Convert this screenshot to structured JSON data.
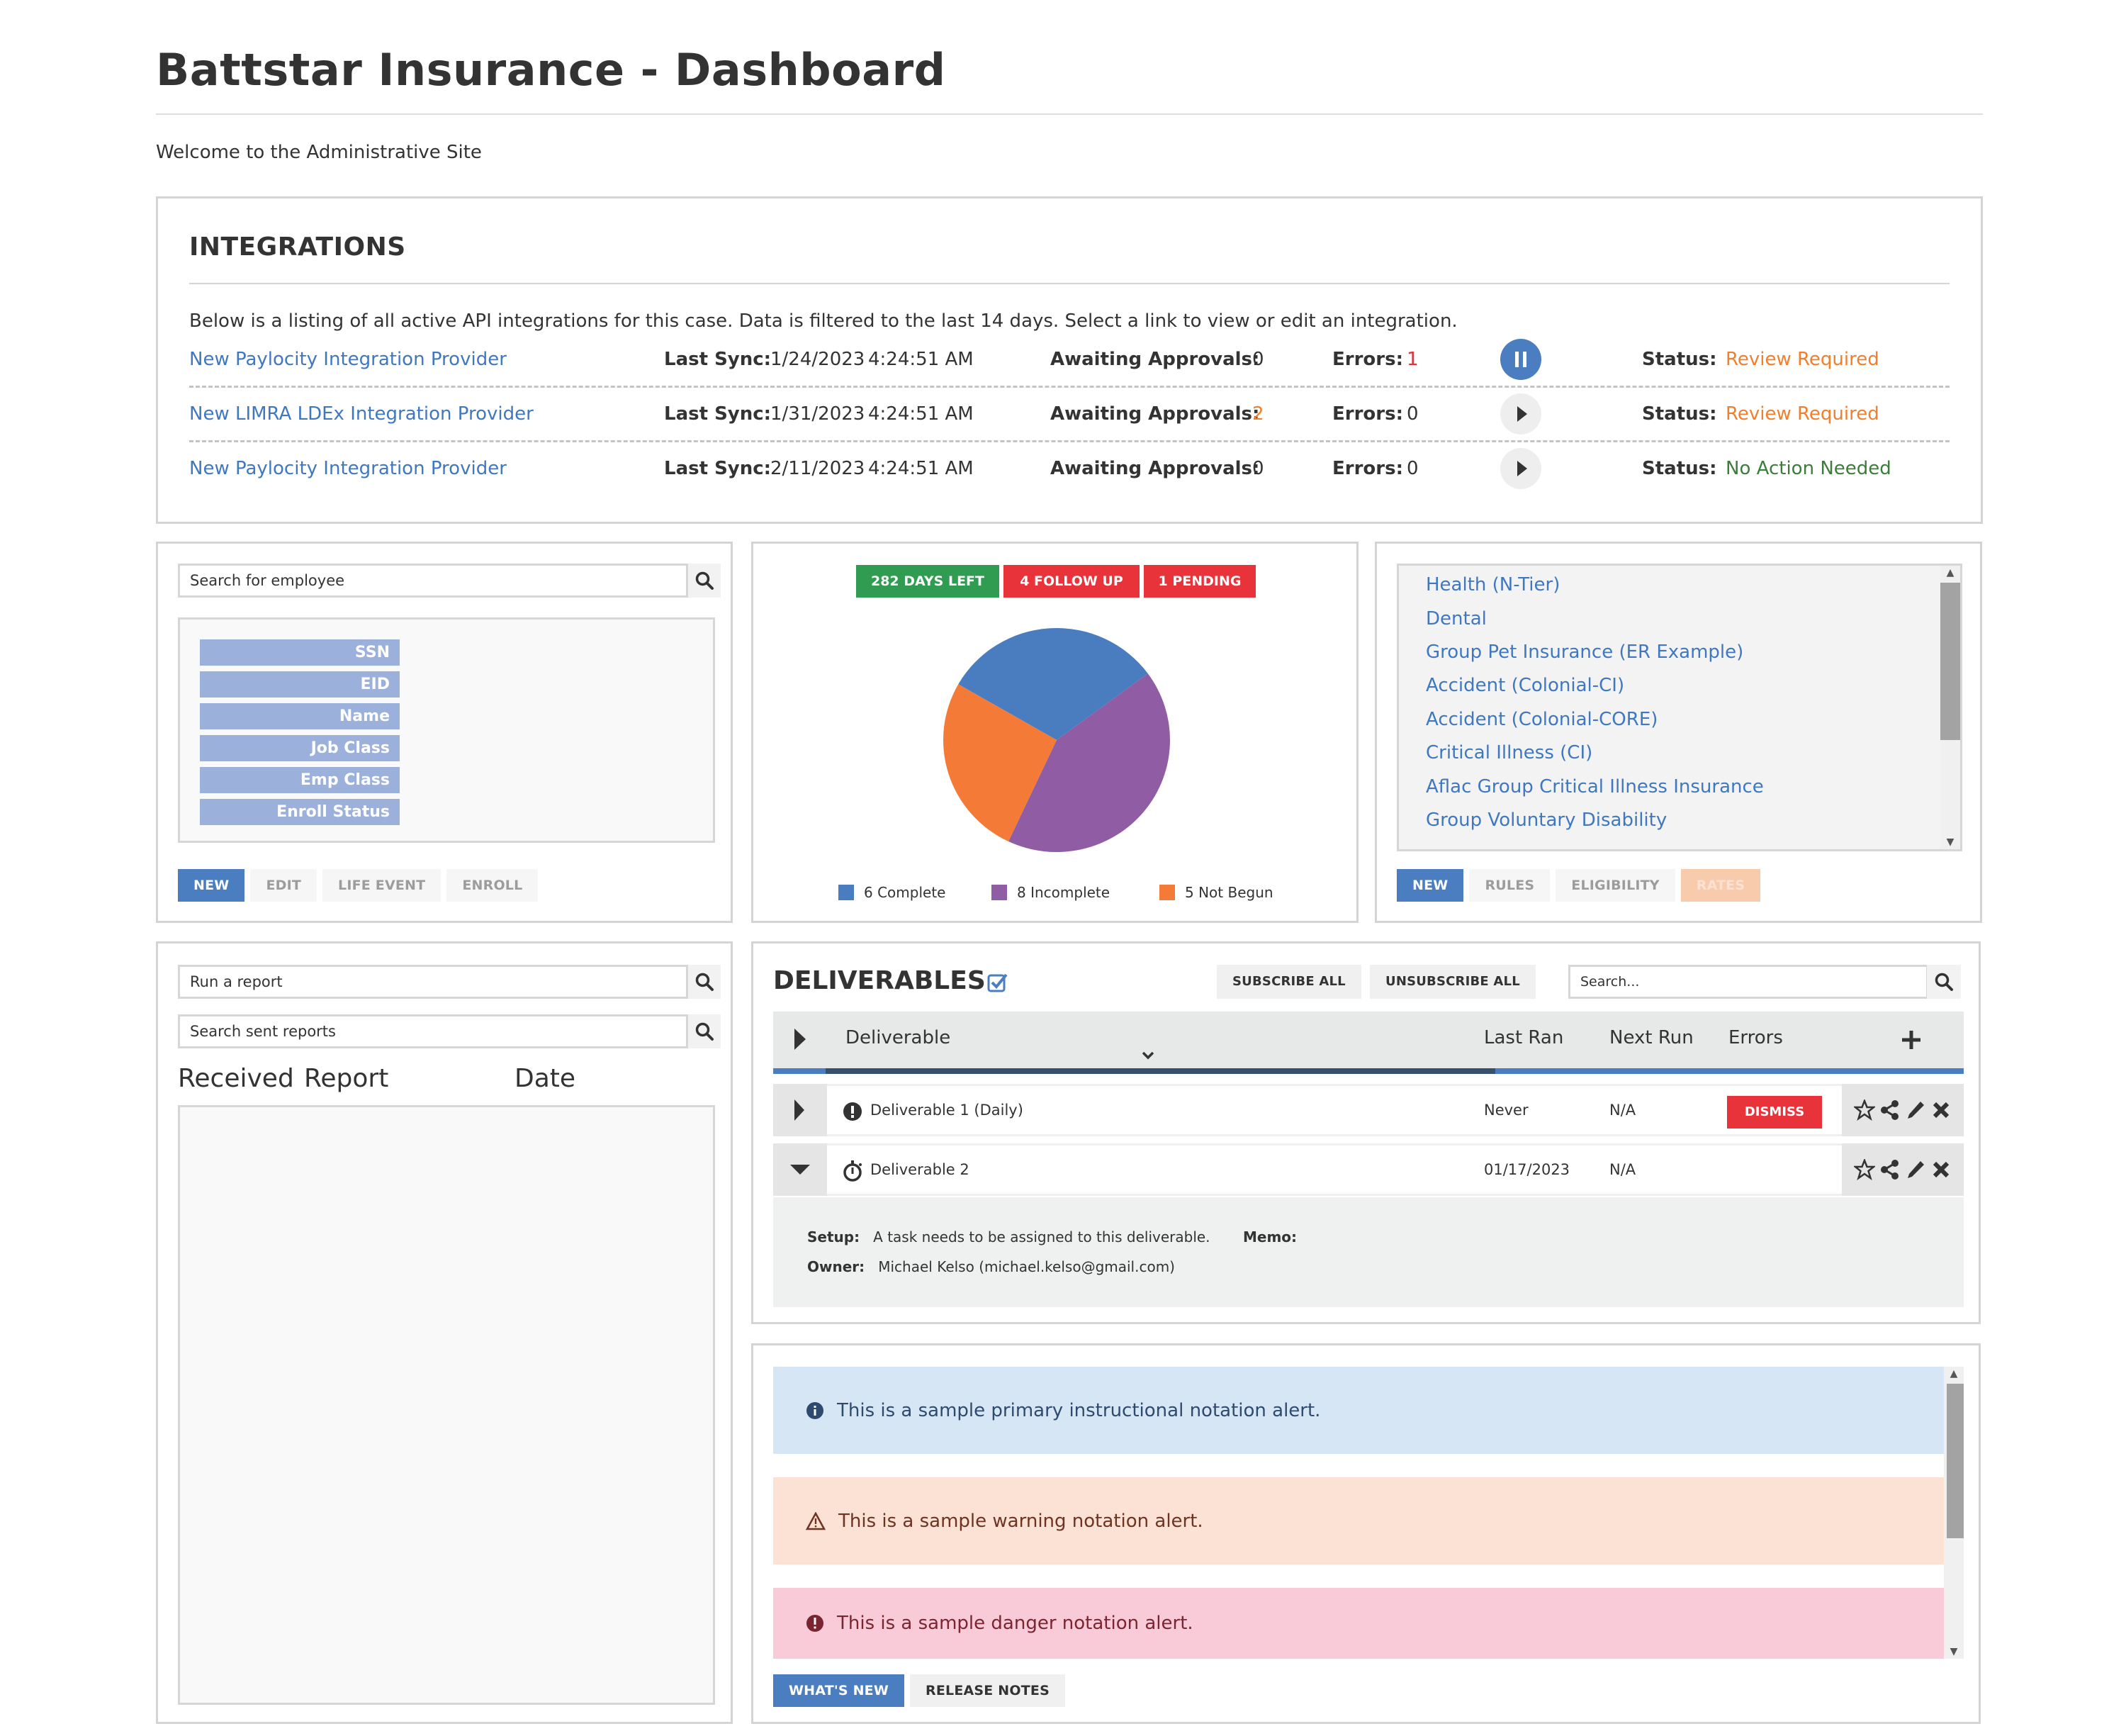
{
  "header": {
    "title": "Battstar Insurance - Dashboard",
    "welcome": "Welcome to the Administrative Site"
  },
  "integrations": {
    "heading": "INTEGRATIONS",
    "description": "Below is a listing of all active API integrations for this case. Data is filtered to the last 14 days. Select a link to view or edit an integration.",
    "labels": {
      "last_sync": "Last Sync:",
      "awaiting": "Awaiting Approvals:",
      "errors": "Errors:",
      "status": "Status:"
    },
    "rows": [
      {
        "name": "New Paylocity Integration Provider",
        "date": "1/24/2023",
        "time": "4:24:51 AM",
        "awaiting": "0",
        "errors": "1",
        "control": "pause",
        "status": "Review Required",
        "status_color": "#f07f2f",
        "awaiting_color": "#333333",
        "errors_color": "#e0323a"
      },
      {
        "name": "New LIMRA LDEx Integration Provider",
        "date": "1/31/2023",
        "time": "4:24:51 AM",
        "awaiting": "2",
        "errors": "0",
        "control": "play",
        "status": "Review Required",
        "status_color": "#f07f2f",
        "awaiting_color": "#f07f2f",
        "errors_color": "#333333"
      },
      {
        "name": "New Paylocity Integration Provider",
        "date": "2/11/2023",
        "time": "4:24:51 AM",
        "awaiting": "0",
        "errors": "0",
        "control": "play",
        "status": "No Action Needed",
        "status_color": "#3c7d3a",
        "awaiting_color": "#333333",
        "errors_color": "#333333"
      }
    ]
  },
  "employees": {
    "search_placeholder": "Search for employee",
    "fields": [
      "SSN",
      "EID",
      "Name",
      "Job Class",
      "Emp Class",
      "Enroll Status"
    ],
    "buttons": {
      "new": "NEW",
      "edit": "EDIT",
      "life_event": "LIFE EVENT",
      "enroll": "ENROLL"
    }
  },
  "enrollment": {
    "badges": [
      {
        "label": "282 DAYS LEFT",
        "color": "#2f9c52"
      },
      {
        "label": "4 FOLLOW UP",
        "color": "#e8333b"
      },
      {
        "label": "1 PENDING",
        "color": "#e8333b"
      }
    ]
  },
  "chart_data": {
    "type": "pie",
    "title": "",
    "categories": [
      "Complete",
      "Incomplete",
      "Not Begun"
    ],
    "values": [
      6,
      8,
      5
    ],
    "colors": [
      "#4a7dbf",
      "#905ca4",
      "#f47b37"
    ],
    "legend": [
      "6 Complete",
      "8 Incomplete",
      "5 Not Begun"
    ],
    "legend_position": "bottom"
  },
  "plans": {
    "items": [
      "Health (N-Tier)",
      "Dental",
      "Group Pet Insurance (ER Example)",
      "Accident (Colonial-CI)",
      "Accident (Colonial-CORE)",
      "Critical Illness (CI)",
      "Aflac Group Critical Illness Insurance",
      "Group Voluntary Disability"
    ],
    "buttons": {
      "new": "NEW",
      "rules": "RULES",
      "eligibility": "ELIGIBILITY",
      "rates": "RATES"
    }
  },
  "reports": {
    "run_placeholder": "Run a report",
    "sent_placeholder": "Search sent reports",
    "columns": [
      "Received",
      "Report",
      "Date"
    ]
  },
  "deliverables": {
    "title": "DELIVERABLES",
    "subscribe_all": "SUBSCRIBE ALL",
    "unsubscribe_all": "UNSUBSCRIBE ALL",
    "search_placeholder": "Search...",
    "columns": {
      "deliverable": "Deliverable",
      "last_ran": "Last Ran",
      "next_run": "Next Run",
      "errors": "Errors"
    },
    "rows": [
      {
        "name": "Deliverable 1 (Daily)",
        "icon": "exclamation-circle",
        "last_ran": "Never",
        "next_run": "N/A",
        "error_action": "DISMISS",
        "expanded": false
      },
      {
        "name": "Deliverable 2",
        "icon": "stopwatch",
        "last_ran": "01/17/2023",
        "next_run": "N/A",
        "error_action": "",
        "expanded": true
      }
    ],
    "detail": {
      "setup_label": "Setup:",
      "setup_value": "A task needs to be assigned to this deliverable.",
      "memo_label": "Memo:",
      "memo_value": "",
      "owner_label": "Owner:",
      "owner_value": "Michael Kelso (michael.kelso@gmail.com)"
    }
  },
  "alerts": {
    "items": [
      {
        "type": "info",
        "text": "This is a sample primary instructional notation alert."
      },
      {
        "type": "warning",
        "text": "This is a sample warning notation alert."
      },
      {
        "type": "danger",
        "text": "This is a sample danger notation alert."
      }
    ],
    "buttons": {
      "whats_new": "WHAT'S NEW",
      "release_notes": "RELEASE NOTES"
    }
  }
}
